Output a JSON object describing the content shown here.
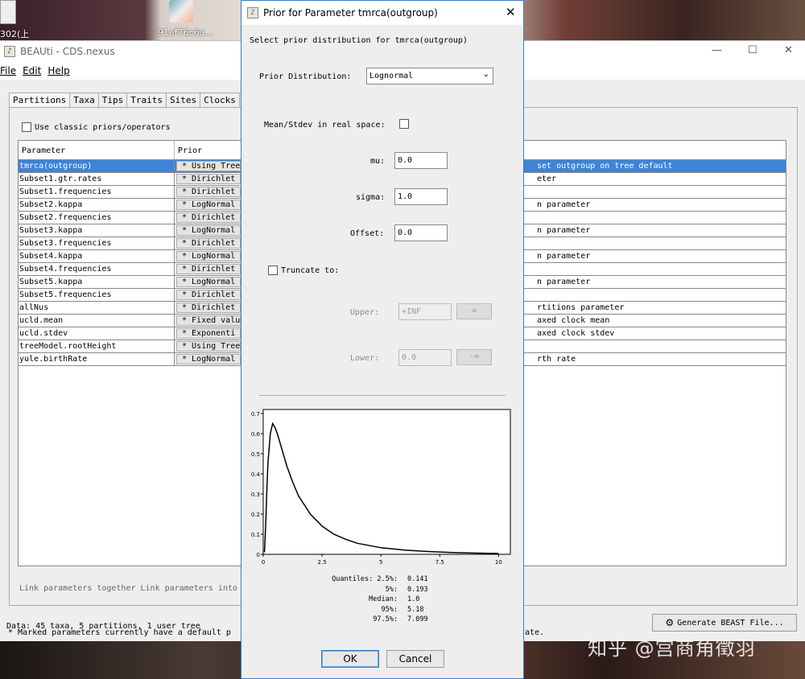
{
  "desktop": {
    "icon1_label": "302(上",
    "icon2_label": "91ef76c6a...",
    "watermark": "知乎 @宫商角徵羽"
  },
  "main_window": {
    "title": "BEAUti - CDS.nexus",
    "menu": [
      "File",
      "Edit",
      "Help"
    ],
    "tabs": [
      "Partitions",
      "Taxa",
      "Tips",
      "Traits",
      "Sites",
      "Clocks",
      "T"
    ],
    "classic_checkbox_label": "Use classic priors/operators",
    "table": {
      "columns": [
        "Parameter",
        "Prior"
      ],
      "rows": [
        {
          "param": "tmrca(outgroup)",
          "prior": "* Using Tree",
          "desc": "set outgroup on tree default",
          "selected": true
        },
        {
          "param": "Subset1.gtr.rates",
          "prior": "* Dirichlet",
          "desc": "eter"
        },
        {
          "param": "Subset1.frequencies",
          "prior": "* Dirichlet",
          "desc": ""
        },
        {
          "param": "Subset2.kappa",
          "prior": "* LogNormal",
          "desc": "n parameter"
        },
        {
          "param": "Subset2.frequencies",
          "prior": "* Dirichlet",
          "desc": ""
        },
        {
          "param": "Subset3.kappa",
          "prior": "* LogNormal",
          "desc": "n parameter"
        },
        {
          "param": "Subset3.frequencies",
          "prior": "* Dirichlet",
          "desc": ""
        },
        {
          "param": "Subset4.kappa",
          "prior": "* LogNormal",
          "desc": "n parameter"
        },
        {
          "param": "Subset4.frequencies",
          "prior": "* Dirichlet",
          "desc": ""
        },
        {
          "param": "Subset5.kappa",
          "prior": "* LogNormal",
          "desc": "n parameter"
        },
        {
          "param": "Subset5.frequencies",
          "prior": "* Dirichlet",
          "desc": ""
        },
        {
          "param": "allNus",
          "prior": "* Dirichlet",
          "desc": "rtitions parameter"
        },
        {
          "param": "ucld.mean",
          "prior": "* Fixed valu",
          "desc": "axed clock mean"
        },
        {
          "param": "ucld.stdev",
          "prior": "* Exponenti",
          "desc": "axed clock stdev"
        },
        {
          "param": "treeModel.rootHeight",
          "prior": "* Using Tree",
          "desc": ""
        },
        {
          "param": "yule.birthRate",
          "prior": "* LogNormal",
          "desc": "rth rate"
        }
      ]
    },
    "link_text": "Link parameters together Link parameters into",
    "marked_text_left": "* Marked parameters currently have a default p",
    "marked_text_right": "ate.",
    "status": "Data: 45 taxa, 5 partitions, 1 user tree",
    "generate_button": "Generate BEAST File..."
  },
  "dialog": {
    "title": "Prior for Parameter tmrca(outgroup)",
    "heading": "Select prior distribution for tmrca(outgroup)",
    "prior_distribution_label": "Prior Distribution:",
    "prior_distribution_value": "Lognormal",
    "mean_stdev_label": "Mean/Stdev in real space:",
    "mu_label": "mu:",
    "mu_value": "0.0",
    "sigma_label": "sigma:",
    "sigma_value": "1.0",
    "offset_label": "Offset:",
    "offset_value": "0.0",
    "truncate_label": "Truncate to:",
    "upper_label": "Upper:",
    "upper_value": "+INF",
    "upper_btn": "∞",
    "lower_label": "Lower:",
    "lower_value": "0.0",
    "lower_btn": "-∞",
    "quantiles": [
      {
        "label": "Quantiles: 2.5%:",
        "value": "0.141"
      },
      {
        "label": "5%:",
        "value": "0.193"
      },
      {
        "label": "Median:",
        "value": "1.0"
      },
      {
        "label": "95%:",
        "value": "5.18"
      },
      {
        "label": "97.5%:",
        "value": "7.099"
      }
    ],
    "ok_label": "OK",
    "cancel_label": "Cancel"
  },
  "chart_data": {
    "type": "line",
    "title": "",
    "xlabel": "",
    "ylabel": "",
    "xlim": [
      0,
      10.5
    ],
    "ylim": [
      0,
      0.72
    ],
    "xticks": [
      "0",
      "2.5",
      "5",
      "7.5",
      "10"
    ],
    "yticks": [
      "0",
      "0.1",
      "0.2",
      "0.3",
      "0.4",
      "0.5",
      "0.6",
      "0.7"
    ],
    "series": [
      {
        "x": [
          0.05,
          0.1,
          0.15,
          0.2,
          0.3,
          0.4,
          0.5,
          0.6,
          0.8,
          1.0,
          1.25,
          1.5,
          2.0,
          2.5,
          3.0,
          3.5,
          4.0,
          5.0,
          6.0,
          7.0,
          8.0,
          9.0,
          10.0
        ],
        "values": [
          0.01,
          0.13,
          0.31,
          0.45,
          0.6,
          0.65,
          0.63,
          0.6,
          0.52,
          0.44,
          0.36,
          0.29,
          0.2,
          0.14,
          0.1,
          0.075,
          0.055,
          0.033,
          0.021,
          0.014,
          0.009,
          0.006,
          0.004
        ]
      }
    ],
    "grid": false
  }
}
